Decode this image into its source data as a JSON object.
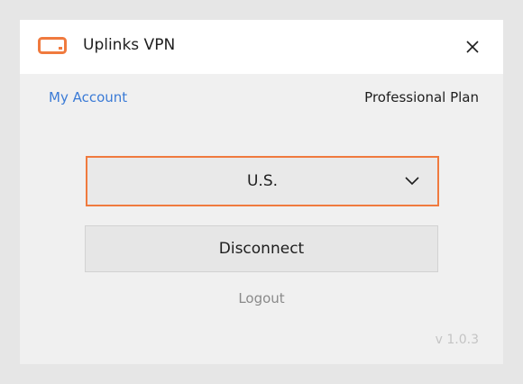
{
  "app": {
    "title": "Uplinks VPN",
    "logo_icon": "vpn-logo-icon",
    "close_icon": "close-icon"
  },
  "account": {
    "link_label": "My Account",
    "plan_label": "Professional Plan"
  },
  "server_select": {
    "value": "U.S.",
    "icon": "chevron-down-icon"
  },
  "actions": {
    "disconnect_label": "Disconnect",
    "logout_label": "Logout"
  },
  "footer": {
    "version": "v 1.0.3"
  },
  "colors": {
    "accent": "#f07a3e",
    "link": "#3b7bd6",
    "window_bg": "#f0f0f0",
    "titlebar_bg": "#ffffff"
  }
}
